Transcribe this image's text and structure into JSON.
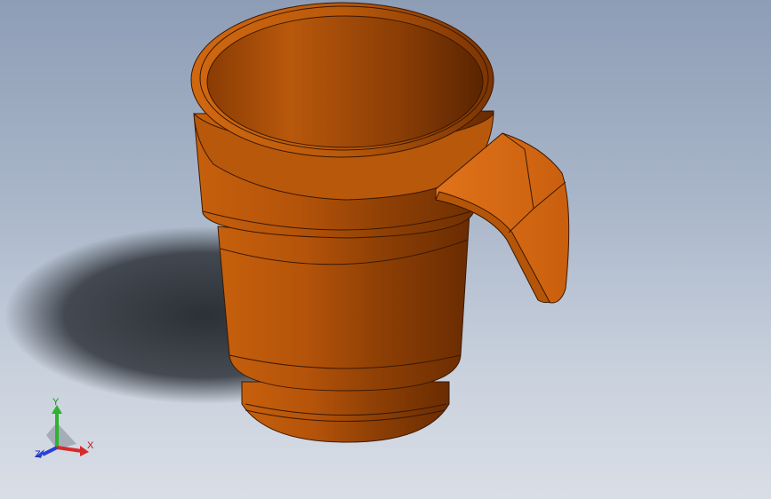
{
  "viewport": {
    "background_top": "#8e9db6",
    "background_bottom": "#d9dee6"
  },
  "model": {
    "name": "mug",
    "body_color": "#c7600d",
    "body_dark_color": "#6e2f02",
    "body_light_color": "#e0751a"
  },
  "triad": {
    "x_label": "X",
    "y_label": "Y",
    "z_label": "Z",
    "x_color": "#d62a2a",
    "y_color": "#2fb22f",
    "z_color": "#2a3fd6"
  }
}
